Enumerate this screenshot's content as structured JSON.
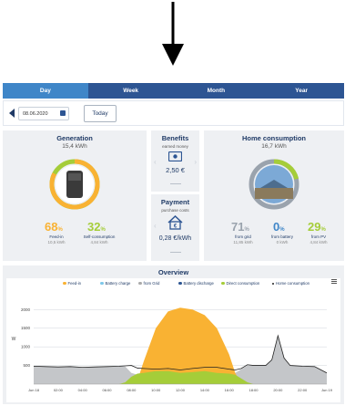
{
  "tabs": [
    "Day",
    "Week",
    "Month",
    "Year"
  ],
  "date_value": "08.06.2020",
  "today_label": "Today",
  "generation": {
    "title": "Generation",
    "value": "15,4 kWh",
    "feed_in_pct": "68",
    "feed_in_label": "Feed-in",
    "feed_in_value": "10,5 kWh",
    "self_pct": "32",
    "self_label": "Self-consumption",
    "self_value": "4,84 kWh",
    "pct_sign": "%"
  },
  "benefits": {
    "title": "Benefits",
    "label": "earned money",
    "value": "2,50 €"
  },
  "payment": {
    "title": "Payment",
    "label": "purchase costs",
    "value": "0,28 €/kWh"
  },
  "home": {
    "title": "Home consumption",
    "value": "16,7 kWh",
    "grid_pct": "71",
    "grid_label": "from grid",
    "grid_value": "11,85 kWh",
    "battery_pct": "0",
    "battery_label": "from battery",
    "battery_value": "0 kWh",
    "pv_pct": "29",
    "pv_label": "from PV",
    "pv_value": "4,84 kWh"
  },
  "overview": {
    "title": "Overview",
    "legend": [
      {
        "label": "Feed-in",
        "color": "#f9b233"
      },
      {
        "label": "Battery charge",
        "color": "#7ec8ea"
      },
      {
        "label": "from Grid",
        "color": "#aaaaaa"
      },
      {
        "label": "Battery discharge",
        "color": "#2d5593"
      },
      {
        "label": "Direct consumption",
        "color": "#a5cd39"
      },
      {
        "label": "Home consumption",
        "color": "#222222"
      }
    ]
  },
  "colors": {
    "accent": "#2d5593",
    "active_tab": "#3f86c8",
    "orange": "#f9b233",
    "green": "#a5cd39",
    "blue": "#3f86c8"
  },
  "icons": {
    "prev": "chevron-left-icon",
    "calendar": "calendar-icon",
    "money": "banknote-icon",
    "house": "house-euro-icon",
    "menu": "hamburger-menu-icon",
    "arrow": "arrow-down-icon"
  },
  "chart_data": {
    "type": "area",
    "ylabel": "W",
    "y_ticks": [
      500,
      1000,
      1500,
      2000
    ],
    "x_ticks": [
      "Jun 18",
      "02:00",
      "04:00",
      "06:00",
      "08:00",
      "10:00",
      "12:00",
      "14:00",
      "16:00",
      "18:00",
      "20:00",
      "22:00",
      "Jun 19"
    ],
    "x_hours": [
      0,
      1,
      2,
      3,
      4,
      5,
      6,
      7,
      7.5,
      8,
      8.5,
      9,
      10,
      11,
      12,
      13,
      14,
      15,
      16,
      16.5,
      17,
      17.5,
      18,
      19,
      19.5,
      20,
      20.5,
      21,
      22,
      23,
      24
    ],
    "series": [
      {
        "name": "Feed-in",
        "values": [
          0,
          0,
          0,
          0,
          0,
          0,
          0,
          0,
          0,
          0,
          100,
          600,
          1500,
          1950,
          2050,
          2000,
          1850,
          1500,
          800,
          300,
          0,
          0,
          0,
          0,
          0,
          0,
          0,
          0,
          0,
          0,
          0
        ]
      },
      {
        "name": "from Grid",
        "values": [
          480,
          470,
          460,
          470,
          450,
          460,
          470,
          480,
          470,
          300,
          250,
          200,
          100,
          50,
          50,
          50,
          80,
          120,
          200,
          300,
          400,
          500,
          500,
          500,
          650,
          1300,
          700,
          500,
          480,
          470,
          300
        ]
      },
      {
        "name": "Direct consumption",
        "values": [
          0,
          0,
          0,
          0,
          0,
          0,
          0,
          0,
          50,
          200,
          280,
          300,
          350,
          350,
          300,
          320,
          350,
          300,
          280,
          250,
          150,
          50,
          0,
          0,
          0,
          0,
          0,
          0,
          0,
          0,
          0
        ]
      },
      {
        "name": "Home consumption",
        "values": [
          480,
          470,
          460,
          470,
          450,
          460,
          470,
          480,
          490,
          500,
          430,
          420,
          400,
          420,
          380,
          420,
          450,
          450,
          400,
          380,
          420,
          520,
          500,
          500,
          650,
          1300,
          700,
          500,
          480,
          470,
          300
        ]
      }
    ]
  }
}
